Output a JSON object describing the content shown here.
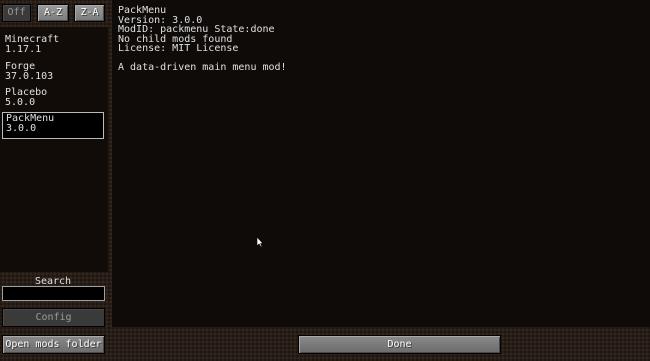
{
  "sort_buttons": {
    "off": "Off",
    "az": "A-Z",
    "za": "Z-A"
  },
  "mods": [
    {
      "name": "Minecraft",
      "version": "1.17.1"
    },
    {
      "name": "Forge",
      "version": "37.0.103"
    },
    {
      "name": "Placebo",
      "version": "5.0.0"
    },
    {
      "name": "PackMenu",
      "version": "3.0.0"
    }
  ],
  "details": {
    "title": "PackMenu",
    "version_line": "Version: 3.0.0",
    "modid_line": "ModID: packmenu State:done",
    "children_line": "No child mods found",
    "license_line": "License: MIT License",
    "description": "A data-driven main menu mod!"
  },
  "search": {
    "label": "Search",
    "value": ""
  },
  "buttons": {
    "config": "Config",
    "open_folder": "Open mods folder",
    "done": "Done"
  }
}
